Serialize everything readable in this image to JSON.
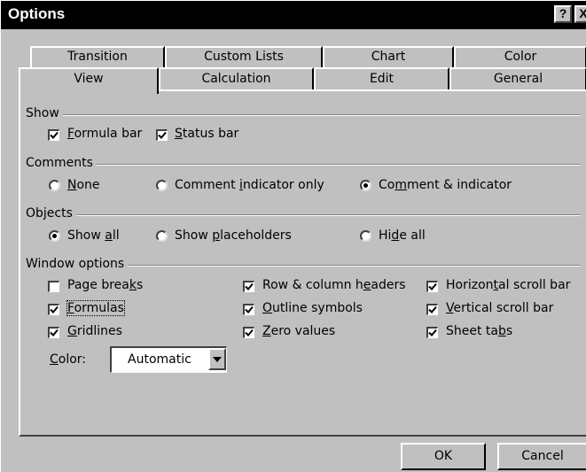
{
  "window": {
    "title": "Options",
    "help_glyph": "?",
    "close_glyph": "X"
  },
  "tabs": {
    "row1": [
      "Transition",
      "Custom Lists",
      "Chart",
      "Color"
    ],
    "row2": [
      "View",
      "Calculation",
      "Edit",
      "General"
    ],
    "selected": "View"
  },
  "show": {
    "label": "Show",
    "formula_bar": {
      "label": "Formula bar",
      "checked": true
    },
    "status_bar": {
      "label": "Status bar",
      "checked": true
    }
  },
  "comments": {
    "label": "Comments",
    "options": [
      "None",
      "Comment indicator only",
      "Comment & indicator"
    ],
    "selected": "Comment & indicator"
  },
  "objects": {
    "label": "Objects",
    "options": [
      "Show all",
      "Show placeholders",
      "Hide all"
    ],
    "selected": "Show all"
  },
  "window_options": {
    "label": "Window options",
    "page_breaks": {
      "label": "Page breaks",
      "checked": false
    },
    "formulas": {
      "label": "Formulas",
      "checked": true
    },
    "gridlines": {
      "label": "Gridlines",
      "checked": true
    },
    "row_col_headers": {
      "label": "Row & column headers",
      "checked": true
    },
    "outline_symbols": {
      "label": "Outline symbols",
      "checked": true
    },
    "zero_values": {
      "label": "Zero values",
      "checked": true
    },
    "horizontal_scroll": {
      "label": "Horizontal scroll bar",
      "checked": true
    },
    "vertical_scroll": {
      "label": "Vertical scroll bar",
      "checked": true
    },
    "sheet_tabs": {
      "label": "Sheet tabs",
      "checked": true
    },
    "color_label": "Color:",
    "color_value": "Automatic"
  },
  "buttons": {
    "ok": "OK",
    "cancel": "Cancel"
  }
}
